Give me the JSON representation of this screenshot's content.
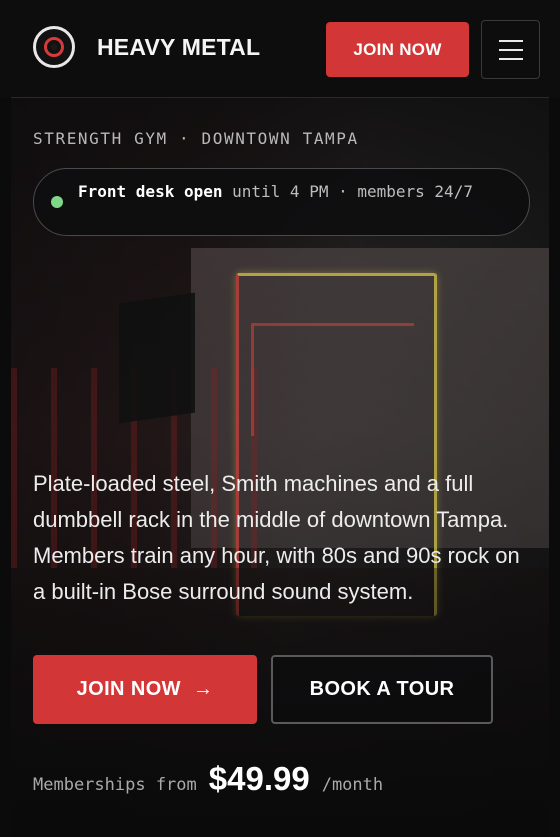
{
  "header": {
    "brand": "HEAVY METAL",
    "join_label": "JOIN NOW",
    "menu_icon": "hamburger-menu-icon",
    "logo_icon": "record-disc-logo-icon"
  },
  "hero": {
    "eyebrow": "STRENGTH GYM · DOWNTOWN TAMPA",
    "status": {
      "indicator_color": "#7fd88a",
      "strong": "Front desk open",
      "rest": " until 4 PM · members 24/7"
    },
    "description": "Plate-loaded steel, Smith machines and a full dumbbell rack in the middle of downtown Tampa. Members train any hour, with 80s and 90s rock on a built-in Bose surround sound system.",
    "primary_cta": "JOIN NOW",
    "primary_cta_arrow": "→",
    "secondary_cta": "BOOK A TOUR",
    "pricing": {
      "prefix": "Memberships from",
      "price": "$49.99",
      "suffix": "/month"
    }
  },
  "colors": {
    "accent": "#d33636",
    "background": "#0b0b0c",
    "status_green": "#7fd88a"
  }
}
